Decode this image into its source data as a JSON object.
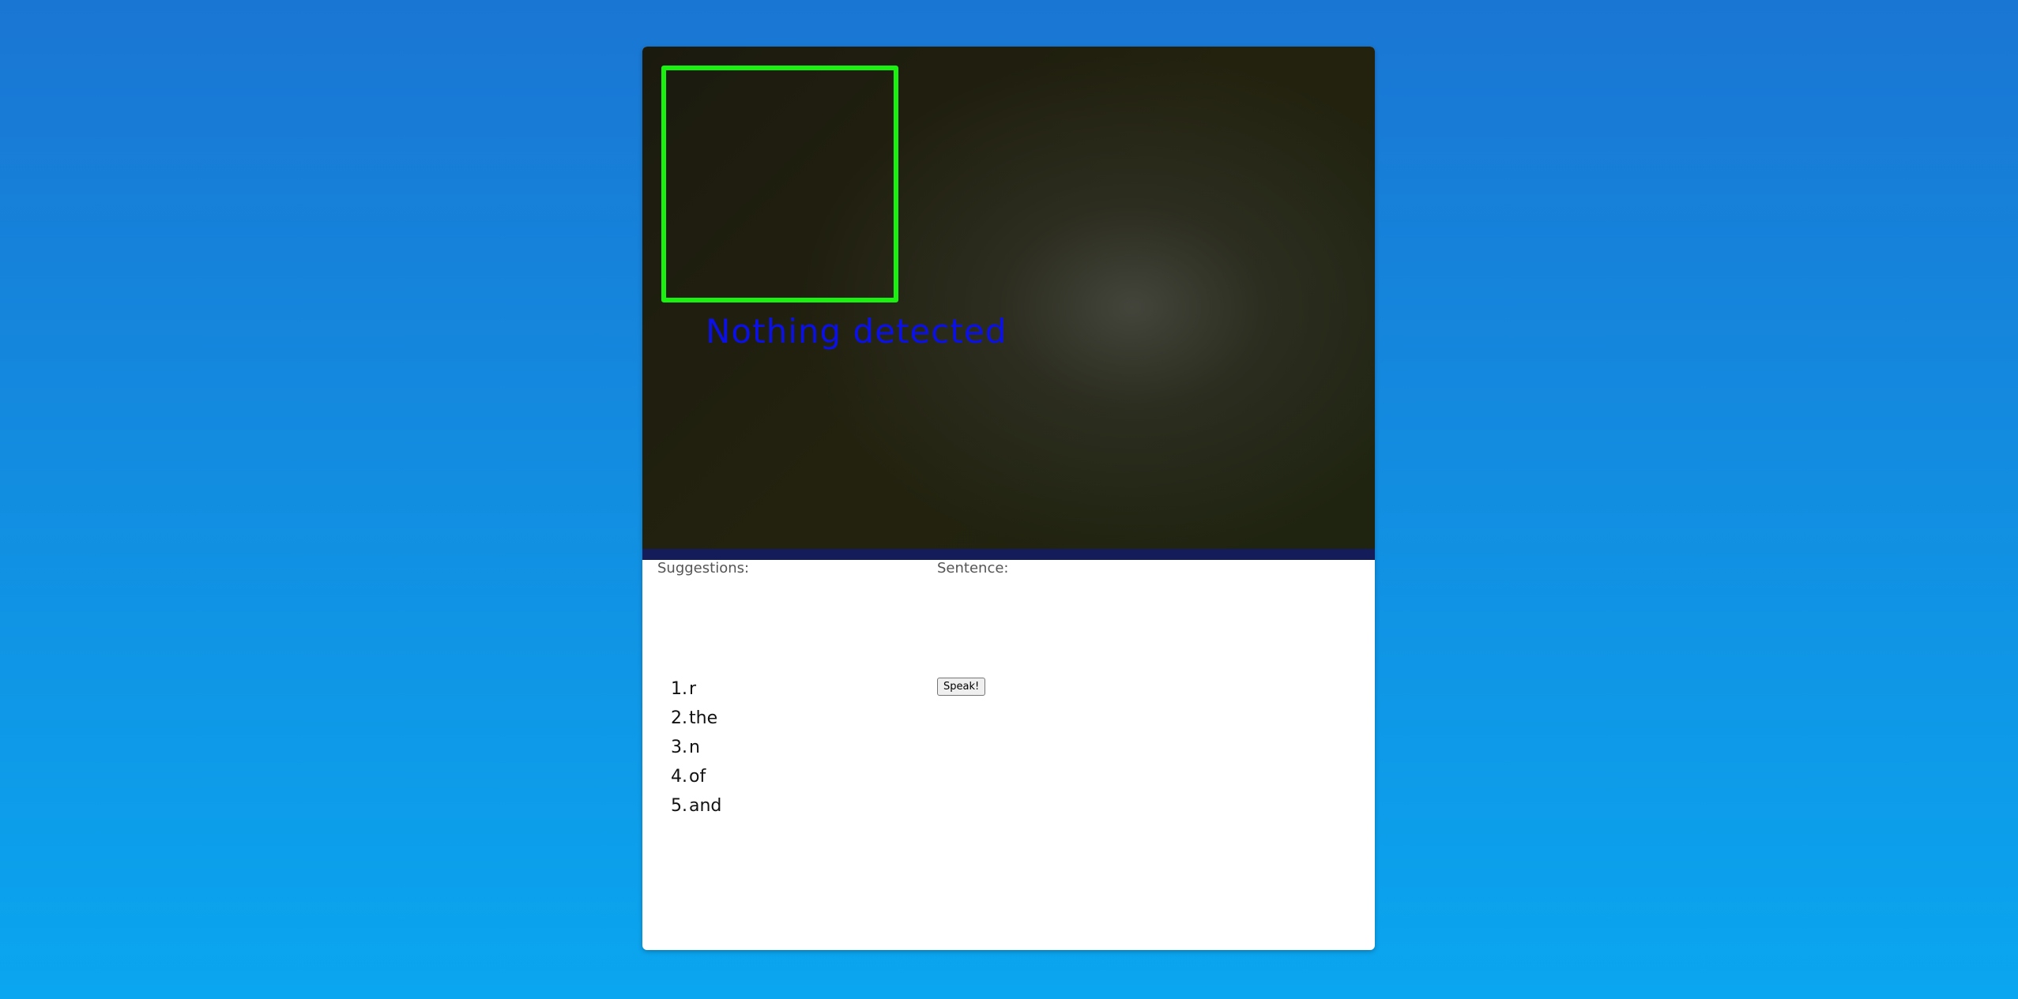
{
  "video": {
    "overlay_text": "Nothing detected",
    "roi_color": "#19f20f",
    "overlay_color": "#0b11e6"
  },
  "suggestions": {
    "label": "Suggestions:",
    "items": [
      {
        "num": "1.",
        "word": "r"
      },
      {
        "num": "2.",
        "word": "the"
      },
      {
        "num": "3.",
        "word": "n"
      },
      {
        "num": "4.",
        "word": "of"
      },
      {
        "num": "5.",
        "word": "and"
      }
    ]
  },
  "sentence": {
    "label": "Sentence:",
    "value": "",
    "speak_label": "Speak!"
  }
}
